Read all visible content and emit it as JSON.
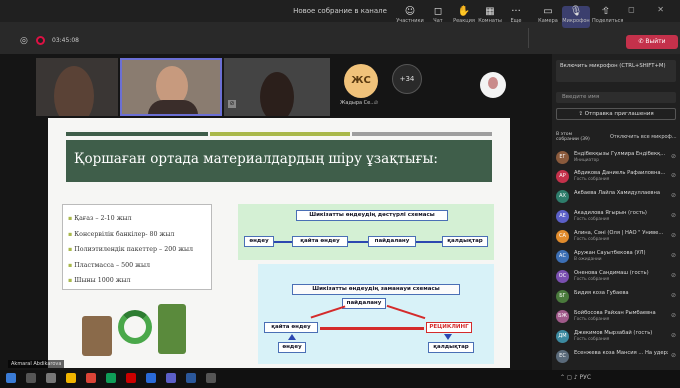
{
  "window": {
    "title": "Новое собрание в канале",
    "controls": "–  ◻  ✕"
  },
  "meeting": {
    "time": "03:45:08"
  },
  "toolbar": {
    "items": [
      "Участники",
      "Чат",
      "Реакция",
      "Комнаты",
      "Еще",
      "Камера",
      "Микрофон",
      "Поделиться"
    ],
    "leave_label": "Выйти"
  },
  "tiles": {
    "initials": "ЖС",
    "zhs_name": "Жадыра Се...",
    "more_count": "+34",
    "presenter_label": "Akmaral Abdikarova"
  },
  "slide": {
    "title": "Қоршаған ортада материалдардың шіру ұзақтығы:",
    "items": [
      "Қағаз – 2-10 жыл",
      "Консервілік банкілер- 80 жыл",
      "Полиэтилендік пакеттер – 200 жыл",
      "Пластмасса – 500 жыл",
      "Шыны   1000 жыл"
    ],
    "scheme1": {
      "title": "Шикізатты өндеудің дәстүрлі схемасы",
      "steps": [
        "өндеу",
        "қайта өндеу",
        "пайдалану",
        "қалдықтар"
      ]
    },
    "scheme2": {
      "title": "Шикізатты өндеудің заманауи схемасы",
      "n_use": "пайдалану",
      "n_rework": "қайта өндеу",
      "n_recycle": "РЕЦИКЛИНГ",
      "n_process": "өндеу",
      "n_waste": "қалдықтар"
    }
  },
  "panel": {
    "mic_hint": "Включить микрофон (CTRL+SHIFT+M)",
    "search_placeholder": "Введите имя",
    "invite_label": "Отправка приглашения",
    "section_label": "В этом собрании (39)",
    "mute_all": "Отключить все микроф...",
    "participants": [
      {
        "initials": "ЕГ",
        "name": "Ендібекқызы Гүлмира Ендібекқ...",
        "role": "Инициатор",
        "color": "#8a5a3c"
      },
      {
        "initials": "АР",
        "name": "Абдикова Даниель Рафаиловна...",
        "role": "Гость собрания",
        "color": "#c4314b"
      },
      {
        "initials": "АХ",
        "name": "Акбаева Лайла Хамидуллаевна",
        "role": "",
        "color": "#2e7d6b"
      },
      {
        "initials": "АЕ",
        "name": "Акадилова Ягырын (гость)",
        "role": "Гость собрания",
        "color": "#5b5fc7"
      },
      {
        "initials": "СА",
        "name": "Алина, Сәні (Оля | НАО \" Униве...",
        "role": "Гость собрания",
        "color": "#e08b2c"
      },
      {
        "initials": "АС",
        "name": "Аружан Сауытбекова (УЛ)",
        "role": "В ожидании",
        "color": "#3c6fb5"
      },
      {
        "initials": "ОС",
        "name": "Оненова Сандимаш (гость)",
        "role": "Гость собрания",
        "color": "#7a4fb0"
      },
      {
        "initials": "БГ",
        "name": "Бидия коза Губаева",
        "role": "",
        "color": "#4a7a3c"
      },
      {
        "initials": "БЖ",
        "name": "Бойбосова Райхан Рымбаевна",
        "role": "Гость собрания",
        "color": "#a05a8a"
      },
      {
        "initials": "ДМ",
        "name": "Джекимов Мырзабай (гость)",
        "role": "Гость собрания",
        "color": "#3c8aa0"
      },
      {
        "initials": "ЕС",
        "name": "Есенжева коза Мансия ... На удержании",
        "role": "",
        "color": "#5a6a7a"
      }
    ]
  }
}
